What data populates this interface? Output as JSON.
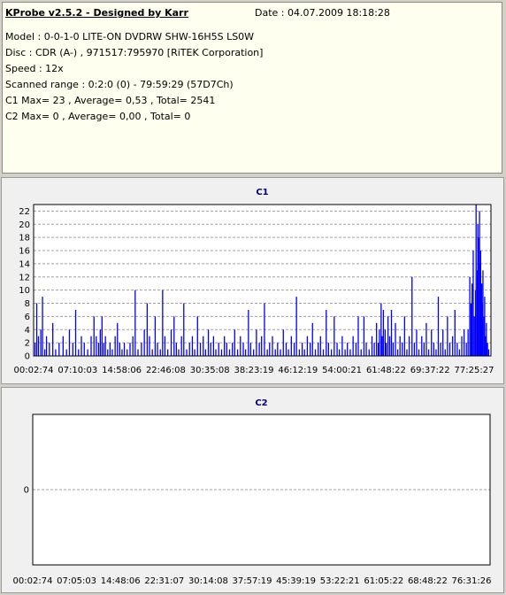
{
  "header": {
    "title": "KProbe v2.5.2 - Designed by Karr",
    "date": "Date : 04.07.2009 18:18:28",
    "lines": [
      "Model : 0-0-1-0 LITE-ON DVDRW SHW-16H5S  LS0W",
      "Disc : CDR (A-) , 971517:795970 [RiTEK Corporation]",
      "Speed : 12x",
      "Scanned range : 0:2:0 (0) - 79:59:29 (57D7Ch)",
      "C1 Max= 23 , Average= 0,53 , Total= 2541",
      "C2 Max= 0 , Average= 0,00 , Total= 0"
    ]
  },
  "colors": {
    "bars": "#0000ff",
    "grid": "#a0a0a0",
    "plot_bg": "#ffffff",
    "title": "#000080"
  },
  "chart_data": [
    {
      "type": "bar",
      "title": "C1",
      "ylim": [
        0,
        23
      ],
      "yticks": [
        0,
        2,
        4,
        6,
        8,
        10,
        12,
        14,
        16,
        18,
        20,
        22
      ],
      "xlim_minutes": [
        0.0457,
        80.0
      ],
      "xticks": [
        "00:02:74",
        "07:10:03",
        "14:58:06",
        "22:46:08",
        "30:35:08",
        "38:23:19",
        "46:12:19",
        "54:00:21",
        "61:48:22",
        "69:37:22",
        "77:25:27"
      ],
      "grid": true,
      "bars": [
        [
          0.3,
          2
        ],
        [
          0.6,
          8
        ],
        [
          0.9,
          3
        ],
        [
          1.3,
          4
        ],
        [
          1.6,
          9
        ],
        [
          2.0,
          1
        ],
        [
          2.3,
          3
        ],
        [
          2.8,
          2
        ],
        [
          3.4,
          5
        ],
        [
          3.9,
          1
        ],
        [
          4.5,
          2
        ],
        [
          5.2,
          3
        ],
        [
          5.8,
          1
        ],
        [
          6.3,
          4
        ],
        [
          6.9,
          2
        ],
        [
          7.4,
          7
        ],
        [
          7.9,
          1
        ],
        [
          8.4,
          3
        ],
        [
          8.9,
          2
        ],
        [
          9.5,
          1
        ],
        [
          10.1,
          3
        ],
        [
          10.6,
          6
        ],
        [
          11.0,
          3
        ],
        [
          11.4,
          2
        ],
        [
          11.7,
          4
        ],
        [
          12.0,
          6
        ],
        [
          12.3,
          2
        ],
        [
          12.6,
          3
        ],
        [
          13.0,
          1
        ],
        [
          13.4,
          2
        ],
        [
          13.8,
          1
        ],
        [
          14.3,
          3
        ],
        [
          14.7,
          5
        ],
        [
          15.1,
          2
        ],
        [
          15.5,
          1
        ],
        [
          15.9,
          2
        ],
        [
          16.4,
          1
        ],
        [
          16.9,
          2
        ],
        [
          17.4,
          3
        ],
        [
          17.8,
          10
        ],
        [
          18.3,
          1
        ],
        [
          18.9,
          2
        ],
        [
          19.4,
          4
        ],
        [
          19.9,
          8
        ],
        [
          20.3,
          3
        ],
        [
          20.8,
          1
        ],
        [
          21.3,
          6
        ],
        [
          21.7,
          2
        ],
        [
          22.2,
          1
        ],
        [
          22.6,
          10
        ],
        [
          23.0,
          3
        ],
        [
          23.5,
          1
        ],
        [
          24.1,
          4
        ],
        [
          24.6,
          6
        ],
        [
          25.0,
          2
        ],
        [
          25.4,
          1
        ],
        [
          25.9,
          3
        ],
        [
          26.3,
          8
        ],
        [
          26.8,
          1
        ],
        [
          27.3,
          2
        ],
        [
          27.8,
          3
        ],
        [
          28.2,
          1
        ],
        [
          28.7,
          6
        ],
        [
          29.2,
          2
        ],
        [
          29.7,
          3
        ],
        [
          30.1,
          1
        ],
        [
          30.6,
          4
        ],
        [
          31.0,
          2
        ],
        [
          31.5,
          3
        ],
        [
          31.9,
          1
        ],
        [
          32.4,
          2
        ],
        [
          32.9,
          1
        ],
        [
          33.4,
          3
        ],
        [
          33.8,
          2
        ],
        [
          34.3,
          1
        ],
        [
          34.8,
          2
        ],
        [
          35.2,
          4
        ],
        [
          35.7,
          1
        ],
        [
          36.2,
          3
        ],
        [
          36.7,
          2
        ],
        [
          37.1,
          1
        ],
        [
          37.6,
          7
        ],
        [
          38.0,
          2
        ],
        [
          38.5,
          1
        ],
        [
          39.0,
          4
        ],
        [
          39.5,
          2
        ],
        [
          39.9,
          3
        ],
        [
          40.4,
          8
        ],
        [
          40.9,
          1
        ],
        [
          41.3,
          2
        ],
        [
          41.8,
          3
        ],
        [
          42.3,
          1
        ],
        [
          42.7,
          2
        ],
        [
          43.2,
          1
        ],
        [
          43.7,
          4
        ],
        [
          44.2,
          2
        ],
        [
          44.6,
          1
        ],
        [
          45.1,
          3
        ],
        [
          45.6,
          2
        ],
        [
          46.0,
          9
        ],
        [
          46.5,
          1
        ],
        [
          47.0,
          2
        ],
        [
          47.4,
          1
        ],
        [
          47.9,
          3
        ],
        [
          48.4,
          2
        ],
        [
          48.8,
          5
        ],
        [
          49.3,
          1
        ],
        [
          49.8,
          2
        ],
        [
          50.2,
          3
        ],
        [
          50.7,
          1
        ],
        [
          51.2,
          7
        ],
        [
          51.6,
          2
        ],
        [
          52.1,
          1
        ],
        [
          52.6,
          6
        ],
        [
          53.1,
          2
        ],
        [
          53.5,
          1
        ],
        [
          54.0,
          3
        ],
        [
          54.5,
          1
        ],
        [
          54.9,
          2
        ],
        [
          55.4,
          1
        ],
        [
          55.9,
          3
        ],
        [
          56.4,
          2
        ],
        [
          56.8,
          6
        ],
        [
          57.3,
          1
        ],
        [
          57.8,
          6
        ],
        [
          58.2,
          2
        ],
        [
          58.7,
          1
        ],
        [
          59.2,
          3
        ],
        [
          59.6,
          2
        ],
        [
          60.0,
          5
        ],
        [
          60.3,
          2
        ],
        [
          60.5,
          4
        ],
        [
          60.8,
          8
        ],
        [
          61.0,
          3
        ],
        [
          61.2,
          7
        ],
        [
          61.5,
          4
        ],
        [
          61.7,
          2
        ],
        [
          62.0,
          6
        ],
        [
          62.3,
          3
        ],
        [
          62.6,
          7
        ],
        [
          62.9,
          2
        ],
        [
          63.3,
          5
        ],
        [
          63.7,
          1
        ],
        [
          64.1,
          3
        ],
        [
          64.5,
          2
        ],
        [
          64.9,
          6
        ],
        [
          65.3,
          1
        ],
        [
          65.7,
          3
        ],
        [
          66.2,
          12
        ],
        [
          66.6,
          2
        ],
        [
          67.0,
          4
        ],
        [
          67.4,
          1
        ],
        [
          67.9,
          3
        ],
        [
          68.3,
          2
        ],
        [
          68.7,
          5
        ],
        [
          69.1,
          1
        ],
        [
          69.6,
          4
        ],
        [
          70.0,
          2
        ],
        [
          70.4,
          1
        ],
        [
          70.8,
          9
        ],
        [
          71.2,
          2
        ],
        [
          71.6,
          4
        ],
        [
          72.0,
          1
        ],
        [
          72.4,
          6
        ],
        [
          72.8,
          2
        ],
        [
          73.3,
          3
        ],
        [
          73.7,
          7
        ],
        [
          74.1,
          2
        ],
        [
          74.5,
          1
        ],
        [
          74.9,
          3
        ],
        [
          75.3,
          4
        ],
        [
          75.7,
          2
        ],
        [
          76.0,
          4
        ],
        [
          76.3,
          12
        ],
        [
          76.5,
          8
        ],
        [
          76.7,
          11
        ],
        [
          76.9,
          16
        ],
        [
          77.1,
          6
        ],
        [
          77.3,
          10
        ],
        [
          77.4,
          23
        ],
        [
          77.6,
          13
        ],
        [
          77.7,
          20
        ],
        [
          77.8,
          18
        ],
        [
          78.0,
          22
        ],
        [
          78.1,
          14
        ],
        [
          78.2,
          16
        ],
        [
          78.4,
          11
        ],
        [
          78.5,
          8
        ],
        [
          78.6,
          13
        ],
        [
          78.8,
          6
        ],
        [
          78.9,
          9
        ],
        [
          79.1,
          3
        ],
        [
          79.2,
          5
        ],
        [
          79.4,
          2
        ],
        [
          79.6,
          1
        ]
      ]
    },
    {
      "type": "bar",
      "title": "C2",
      "ylim": [
        -1,
        1
      ],
      "yticks": [
        0
      ],
      "xlim_minutes": [
        0.0457,
        80.0
      ],
      "xticks": [
        "00:02:74",
        "07:05:03",
        "14:48:06",
        "22:31:07",
        "30:14:08",
        "37:57:19",
        "45:39:19",
        "53:22:21",
        "61:05:22",
        "68:48:22",
        "76:31:26"
      ],
      "grid": true,
      "bars": []
    }
  ]
}
